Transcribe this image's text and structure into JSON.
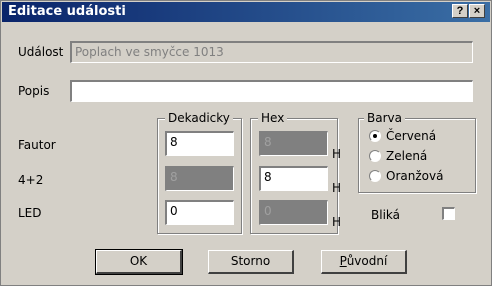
{
  "window": {
    "title": "Editace události",
    "help_button": "?",
    "close_button": "×"
  },
  "udalost": {
    "label": "Událost",
    "value": "Poplach ve smyčce 1013"
  },
  "popis": {
    "label": "Popis",
    "value": ""
  },
  "rows": {
    "fautor": "Fautor",
    "r42": "4+2",
    "led": "LED"
  },
  "dekadicky": {
    "title": "Dekadicky",
    "fautor": "8",
    "r42": "8",
    "led": "0"
  },
  "hex": {
    "title": "Hex",
    "fautor": "8",
    "r42": "8",
    "led": "0",
    "unit": "H"
  },
  "barva": {
    "title": "Barva",
    "options": [
      "Červená",
      "Zelená",
      "Oranžová"
    ],
    "selected": "Červená"
  },
  "blika": {
    "label": "Bliká",
    "checked": false
  },
  "buttons": {
    "ok": "OK",
    "storno": "Storno",
    "puvodni_first": "P",
    "puvodni_rest": "ůvodní"
  }
}
